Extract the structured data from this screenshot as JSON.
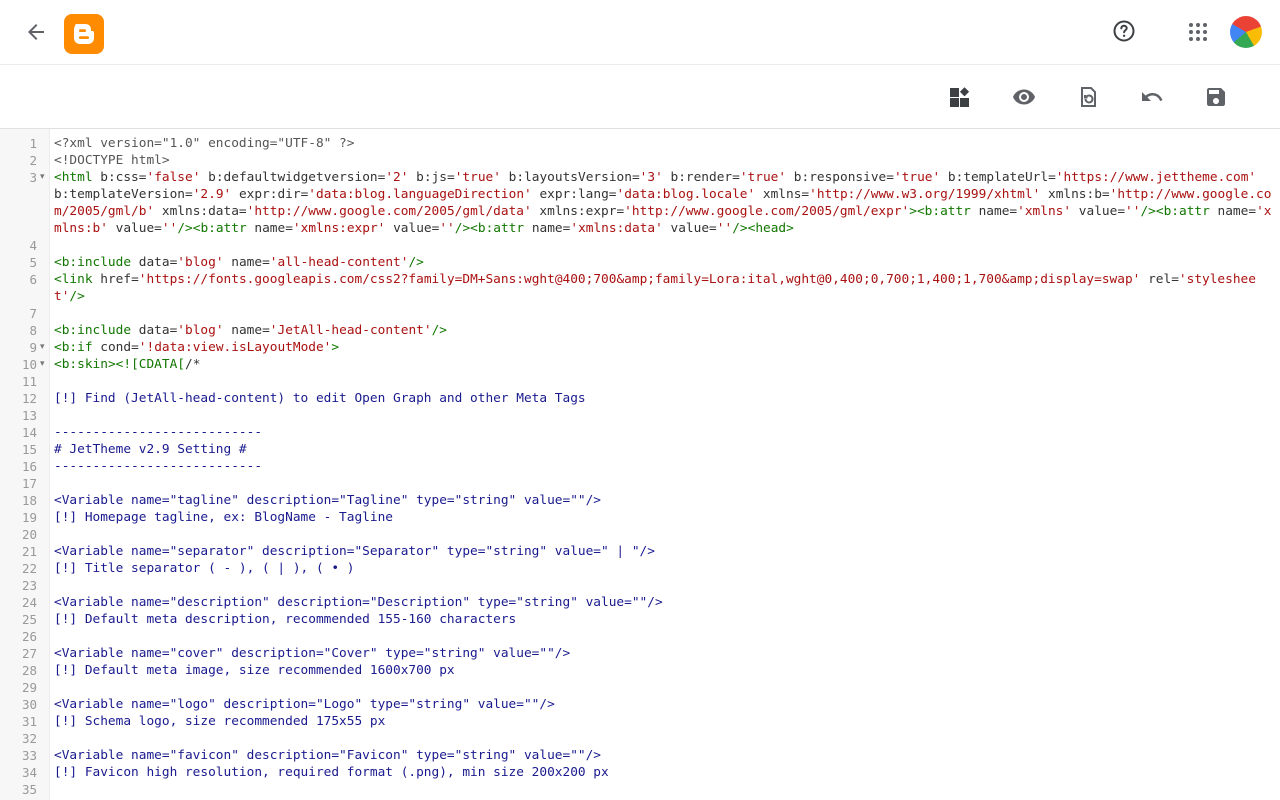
{
  "colors": {
    "brand": "#ff8b00",
    "tag": "#117700",
    "attr": "#0000cc",
    "string": "#aa1111",
    "comment": "#1a1a8f"
  },
  "header": {
    "icons": [
      "back-arrow-icon",
      "blogger-logo",
      "help-icon",
      "apps-grid-icon",
      "account-avatar"
    ],
    "logo_letter": "B"
  },
  "toolbar": {
    "icons": [
      "jump-to-widget-icon",
      "preview-icon",
      "revert-icon",
      "undo-icon",
      "save-icon"
    ]
  },
  "editor": {
    "lines": [
      {
        "n": "1",
        "t": "<?xml version=\"1.0\" encoding=\"UTF-8\" ?>"
      },
      {
        "n": "2",
        "t": "<!DOCTYPE html>"
      },
      {
        "n": "3",
        "fold": true,
        "t": "<html b:css='false' b:defaultwidgetversion='2' b:js='true' b:layoutsVersion='3' b:render='true' b:responsive='true' b:templateUrl='https://www.jettheme.com' b:templateVersion='2.9' expr:dir='data:blog.languageDirection' expr:lang='data:blog.locale' xmlns='http://www.w3.org/1999/xhtml' xmlns:b='http://www.google.com/2005/gml/b' xmlns:data='http://www.google.com/2005/gml/data' xmlns:expr='http://www.google.com/2005/gml/expr'><b:attr name='xmlns' value=''/><b:attr name='xmlns:b' value=''/><b:attr name='xmlns:expr' value=''/><b:attr name='xmlns:data' value=''/><head>"
      },
      {
        "n": "4",
        "t": ""
      },
      {
        "n": "5",
        "t": "<b:include data='blog' name='all-head-content'/>"
      },
      {
        "n": "6",
        "t": "<link href='https://fonts.googleapis.com/css2?family=DM+Sans:wght@400;700&amp;family=Lora:ital,wght@0,400;0,700;1,400;1,700&amp;display=swap' rel='stylesheet'/>"
      },
      {
        "n": "7",
        "t": ""
      },
      {
        "n": "8",
        "t": "<b:include data='blog' name='JetAll-head-content'/>"
      },
      {
        "n": "9",
        "fold": true,
        "t": "<b:if cond='!data:view.isLayoutMode'>"
      },
      {
        "n": "10",
        "fold": true,
        "t": "<b:skin><![CDATA[/*"
      },
      {
        "n": "11",
        "t": ""
      },
      {
        "n": "12",
        "t": "[!] Find (JetAll-head-content) to edit Open Graph and other Meta Tags"
      },
      {
        "n": "13",
        "t": ""
      },
      {
        "n": "14",
        "t": "---------------------------"
      },
      {
        "n": "15",
        "t": "# JetTheme v2.9 Setting #"
      },
      {
        "n": "16",
        "t": "---------------------------"
      },
      {
        "n": "17",
        "t": ""
      },
      {
        "n": "18",
        "t": "<Variable name=\"tagline\" description=\"Tagline\" type=\"string\" value=\"\"/>"
      },
      {
        "n": "19",
        "t": "[!] Homepage tagline, ex: BlogName - Tagline"
      },
      {
        "n": "20",
        "t": ""
      },
      {
        "n": "21",
        "t": "<Variable name=\"separator\" description=\"Separator\" type=\"string\" value=\" | \"/>"
      },
      {
        "n": "22",
        "t": "[!] Title separator ( - ), ( | ), ( • )"
      },
      {
        "n": "23",
        "t": ""
      },
      {
        "n": "24",
        "t": "<Variable name=\"description\" description=\"Description\" type=\"string\" value=\"\"/>"
      },
      {
        "n": "25",
        "t": "[!] Default meta description, recommended 155-160 characters"
      },
      {
        "n": "26",
        "t": ""
      },
      {
        "n": "27",
        "t": "<Variable name=\"cover\" description=\"Cover\" type=\"string\" value=\"\"/>"
      },
      {
        "n": "28",
        "t": "[!] Default meta image, size recommended 1600x700 px"
      },
      {
        "n": "29",
        "t": ""
      },
      {
        "n": "30",
        "t": "<Variable name=\"logo\" description=\"Logo\" type=\"string\" value=\"\"/>"
      },
      {
        "n": "31",
        "t": "[!] Schema logo, size recommended 175x55 px"
      },
      {
        "n": "32",
        "t": ""
      },
      {
        "n": "33",
        "t": "<Variable name=\"favicon\" description=\"Favicon\" type=\"string\" value=\"\"/>"
      },
      {
        "n": "34",
        "t": "[!] Favicon high resolution, required format (.png), min size 200x200 px"
      },
      {
        "n": "35",
        "t": ""
      }
    ]
  }
}
